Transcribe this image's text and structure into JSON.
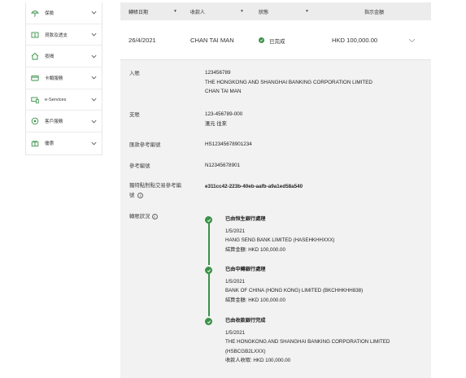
{
  "sidebar": {
    "items": [
      {
        "label": "保險",
        "icon": "umbrella-icon"
      },
      {
        "label": "貸款及透支",
        "icon": "money-icon"
      },
      {
        "label": "按揭",
        "icon": "house-icon"
      },
      {
        "label": "卡類服務",
        "icon": "card-icon"
      },
      {
        "label": "e-Services",
        "icon": "devices-icon"
      },
      {
        "label": "客戶服務",
        "icon": "customer-service-icon"
      },
      {
        "label": "優惠",
        "icon": "gift-icon"
      }
    ]
  },
  "table": {
    "headers": {
      "date": "轉賬日期",
      "payee": "收款人",
      "status": "狀態",
      "amount": "指示金額"
    },
    "row": {
      "date": "26/4/2021",
      "payee": "CHAN TAI MAN",
      "status": "已完成",
      "amount": "HKD 100,000.00"
    }
  },
  "detail": {
    "payee_label": "入賬",
    "payee_account": "123456789",
    "payee_bank": "THE HONGKONG AND SHANGHAI BANKING CORPORATION LIMITED",
    "payee_name": "CHAN TAI MAN",
    "payer_label": "支賬",
    "payer_account": "123-456789-000",
    "payer_name": "滙元 往來",
    "ref_label": "匯款參考編號",
    "ref_value": "HS12345678901234",
    "ref2_label": "參考編號",
    "ref2_value": "N12345678901",
    "e2e_label_1": "獨特點對點交易參考編",
    "e2e_label_2": "號",
    "e2e_value": "e311cc42-223b-40eb-aafb-a9a1ed58a540",
    "status_label": "轉賬狀況"
  },
  "timeline": [
    {
      "title": "已由恒生銀行處理",
      "date": "1/5/2021",
      "bank": "HANG SENG BANK LIMITED (HASEHKHHXXX)",
      "amount": "結算金額: HKD 100,000.00"
    },
    {
      "title": "已由中轉銀行處理",
      "date": "1/5/2021",
      "bank": "BANK OF CHINA (HONG KONG) LIMITED (BKCHHKHH838)",
      "amount": "結算金額: HKD 100,000.00"
    },
    {
      "title": "已由收款銀行完成",
      "date": "1/5/2021",
      "bank": "THE HONGKONG AND SHANGHAI BANKING CORPORATION LIMITED",
      "bank2": "(HSBCGB2LXXX)",
      "amount": "收款人收取: HKD 100,000.00"
    }
  ],
  "colors": {
    "accent_green": "#3a9148",
    "header_bg": "#ececec",
    "detail_bg": "#f2f2f2"
  }
}
